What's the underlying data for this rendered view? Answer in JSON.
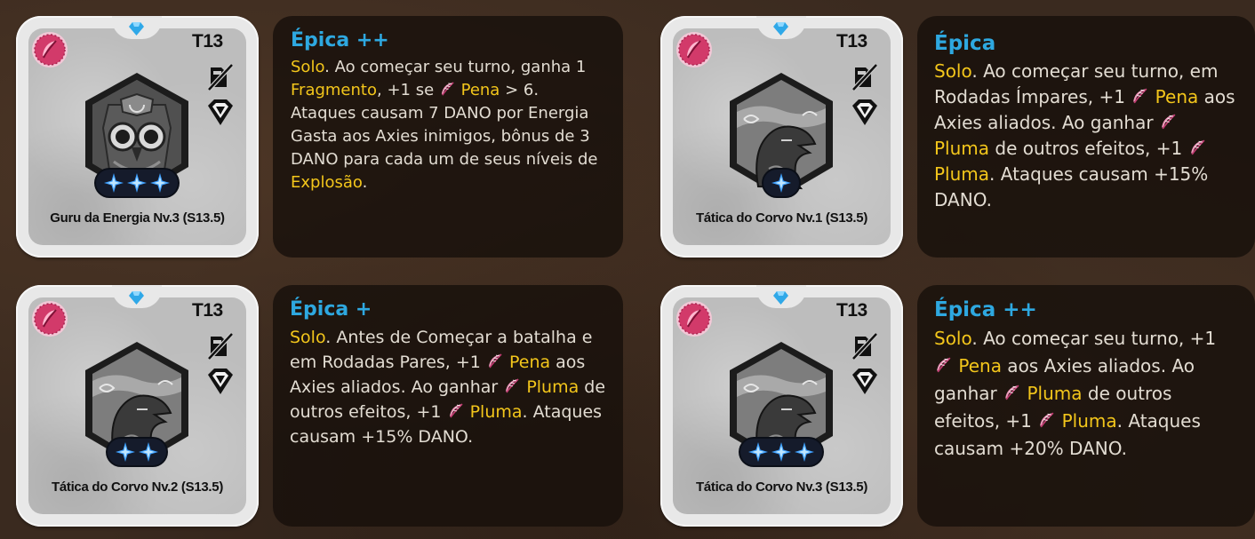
{
  "cards": [
    {
      "tier": "T13",
      "name": "Guru da Energia Nv.3 (S13.5)",
      "stars": 3,
      "portrait": "owl-portrait",
      "rarity": "Épica ++",
      "description": [
        {
          "t": "Solo",
          "hl": true
        },
        {
          "t": ". Ao começar seu turno, ganha 1 "
        },
        {
          "t": "Fragmento",
          "hl": true
        },
        {
          "t": ", +1 se "
        },
        {
          "icon": "feather"
        },
        {
          "t": "Pena",
          "hl": true
        },
        {
          "t": " > 6. Ataques causam 7 DANO por Energia Gasta aos Axies inimigos, bônus de 3 DANO para cada um de seus níveis de "
        },
        {
          "t": "Explosão",
          "hl": true
        },
        {
          "t": "."
        }
      ]
    },
    {
      "tier": "T13",
      "name": "Tática do Corvo Nv.1 (S13.5)",
      "stars": 1,
      "portrait": "crow-portrait",
      "rarity": "Épica",
      "description": [
        {
          "t": "Solo",
          "hl": true
        },
        {
          "t": ". Ao começar seu turno, em Rodadas Ímpares, +1 "
        },
        {
          "icon": "feather"
        },
        {
          "t": "Pena",
          "hl": true
        },
        {
          "t": " aos Axies aliados. Ao ganhar "
        },
        {
          "icon": "feather"
        },
        {
          "t": "Pluma",
          "hl": true
        },
        {
          "t": " de outros efeitos, +1 "
        },
        {
          "icon": "feather"
        },
        {
          "t": "Pluma",
          "hl": true
        },
        {
          "t": ". Ataques causam +15% DANO."
        }
      ]
    },
    {
      "tier": "T13",
      "name": "Tática do Corvo Nv.2 (S13.5)",
      "stars": 2,
      "portrait": "crow-portrait",
      "rarity": "Épica +",
      "description": [
        {
          "t": "Solo",
          "hl": true
        },
        {
          "t": ". Antes de Começar a batalha e em Rodadas Pares, +1 "
        },
        {
          "icon": "feather"
        },
        {
          "t": "Pena",
          "hl": true
        },
        {
          "t": " aos Axies aliados. Ao ganhar "
        },
        {
          "icon": "feather"
        },
        {
          "t": "Pluma",
          "hl": true
        },
        {
          "t": " de outros efeitos, +1 "
        },
        {
          "icon": "feather"
        },
        {
          "t": "Pluma",
          "hl": true
        },
        {
          "t": ". Ataques causam +15% DANO."
        }
      ]
    },
    {
      "tier": "T13",
      "name": "Tática do Corvo Nv.3 (S13.5)",
      "stars": 3,
      "portrait": "crow-portrait",
      "rarity": "Épica ++",
      "description": [
        {
          "t": "Solo",
          "hl": true
        },
        {
          "t": ". Ao começar seu turno, +1 "
        },
        {
          "icon": "feather"
        },
        {
          "t": "Pena",
          "hl": true
        },
        {
          "t": " aos Axies aliados. Ao ganhar "
        },
        {
          "icon": "feather"
        },
        {
          "t": "Pluma",
          "hl": true
        },
        {
          "t": " de outros efeitos, +1 "
        },
        {
          "icon": "feather"
        },
        {
          "t": "Pluma",
          "hl": true
        },
        {
          "t": ". Ataques causam +20% DANO."
        }
      ]
    }
  ],
  "icons": {
    "class": "feather-class-icon",
    "gem": "diamond-gem-icon",
    "cost": "slashed-energy-icon",
    "shield": "shield-icon",
    "star": "four-point-star-icon"
  },
  "colors": {
    "rarity": "#2ea8e0",
    "highlight": "#f3c61b",
    "text": "#e2dcd2",
    "classBadge": "#d23a6a"
  }
}
